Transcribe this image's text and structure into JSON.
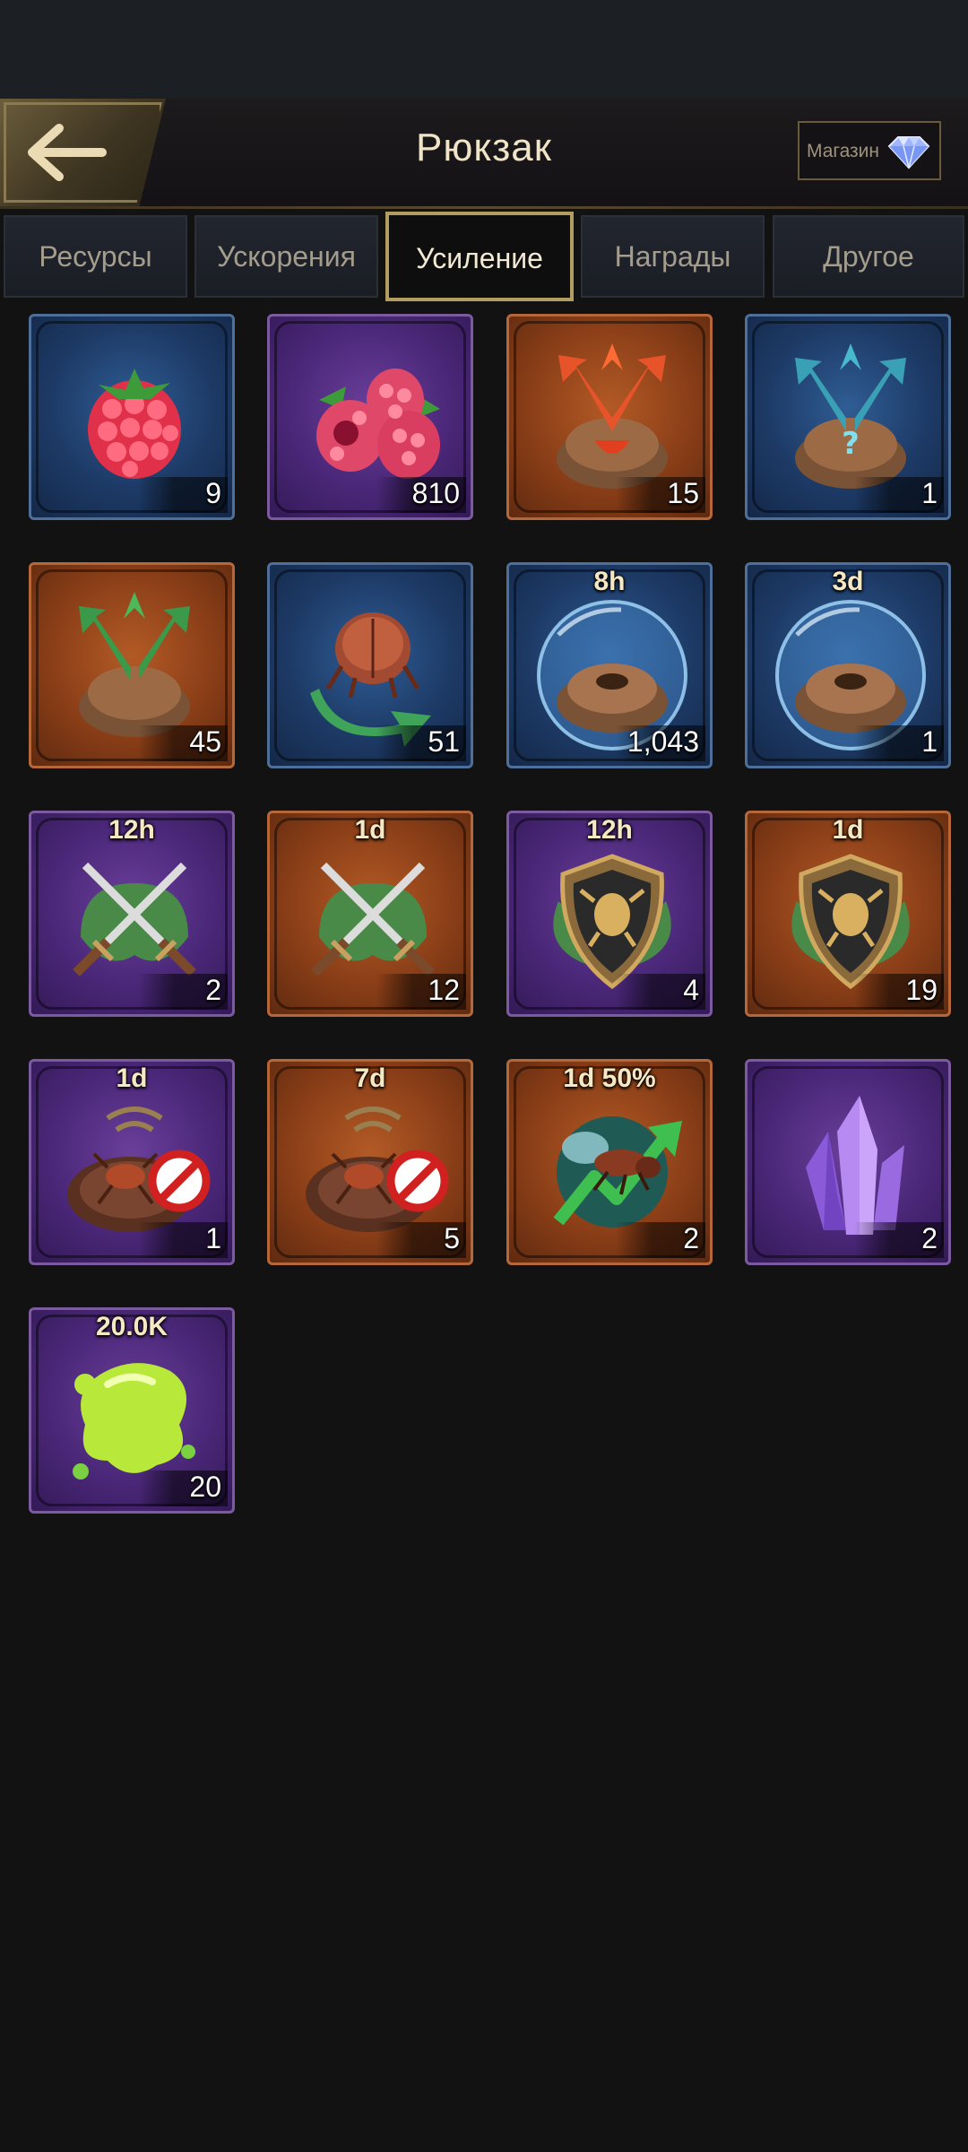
{
  "header": {
    "title": "Рюкзак",
    "shop_label": "Магазин"
  },
  "tabs": [
    {
      "label": "Ресурсы",
      "active": false
    },
    {
      "label": "Ускорения",
      "active": false
    },
    {
      "label": "Усиление",
      "active": true
    },
    {
      "label": "Награды",
      "active": false
    },
    {
      "label": "Другое",
      "active": false
    }
  ],
  "items": [
    {
      "icon": "raspberry-icon",
      "frame": "blue",
      "timer": "",
      "count": "9"
    },
    {
      "icon": "raspberries-bundle-icon",
      "frame": "purple",
      "timer": "",
      "count": "810"
    },
    {
      "icon": "advanced-relocation-icon",
      "frame": "orange",
      "timer": "",
      "count": "15"
    },
    {
      "icon": "random-relocation-icon",
      "frame": "blue",
      "timer": "",
      "count": "1"
    },
    {
      "icon": "relocation-icon",
      "frame": "orange",
      "timer": "",
      "count": "45"
    },
    {
      "icon": "ant-reset-icon",
      "frame": "blue",
      "timer": "",
      "count": "51"
    },
    {
      "icon": "nest-shield-bubble-icon",
      "frame": "blue",
      "timer": "8h",
      "count": "1,043"
    },
    {
      "icon": "nest-shield-bubble-icon",
      "frame": "blue",
      "timer": "3d",
      "count": "1"
    },
    {
      "icon": "attack-boost-icon",
      "frame": "purple",
      "timer": "12h",
      "count": "2"
    },
    {
      "icon": "attack-boost-icon",
      "frame": "orange",
      "timer": "1d",
      "count": "12"
    },
    {
      "icon": "defense-boost-icon",
      "frame": "purple",
      "timer": "12h",
      "count": "4"
    },
    {
      "icon": "defense-boost-icon",
      "frame": "orange",
      "timer": "1d",
      "count": "19"
    },
    {
      "icon": "anti-scout-icon",
      "frame": "purple",
      "timer": "1d",
      "count": "1"
    },
    {
      "icon": "anti-scout-icon",
      "frame": "orange",
      "timer": "7d",
      "count": "5"
    },
    {
      "icon": "growth-boost-icon",
      "frame": "orange",
      "timer": "1d 50%",
      "count": "2"
    },
    {
      "icon": "purple-crystal-icon",
      "frame": "purple",
      "timer": "",
      "count": "2"
    },
    {
      "icon": "honeydew-slime-icon",
      "frame": "purple",
      "timer": "20.0K",
      "count": "20"
    }
  ],
  "colors": {
    "background": "#121212",
    "gold_accent": "#b39c62",
    "frame_blue": "#1d3a66",
    "frame_purple": "#4a2778",
    "frame_orange": "#8a3e17"
  }
}
